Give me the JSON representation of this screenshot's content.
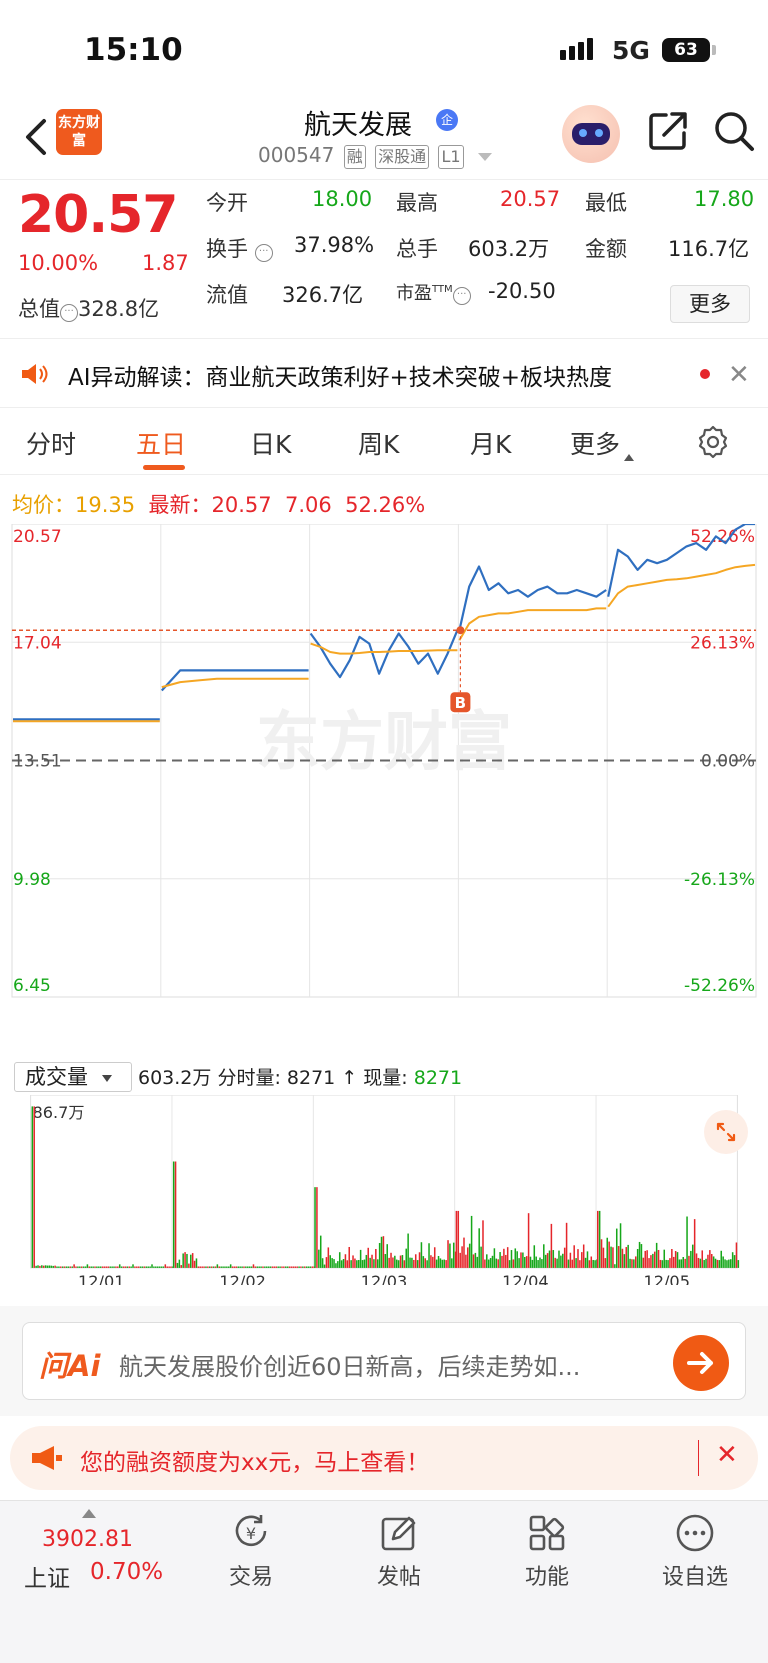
{
  "status": {
    "time": "15:10",
    "network": "5G",
    "battery": "63"
  },
  "header": {
    "logo_text": "东方财富",
    "title": "航天发展",
    "title_badge": "企",
    "code": "000547",
    "tags": [
      "融",
      "深股通",
      "L1"
    ]
  },
  "quote": {
    "price": "20.57",
    "pct": "10.00%",
    "change": "1.87",
    "total_value_label": "总值",
    "total_value": "328.8亿",
    "open_label": "今开",
    "open": "18.00",
    "high_label": "最高",
    "high": "20.57",
    "low_label": "最低",
    "low": "17.80",
    "turnover_label": "换手",
    "turnover": "37.98%",
    "volume_label": "总手",
    "volume": "603.2万",
    "amount_label": "金额",
    "amount": "116.7亿",
    "float_label": "流值",
    "float_value": "326.7亿",
    "pe_label": "市盈",
    "pe_sup": "TTM",
    "pe": "-20.50",
    "more_label": "更多"
  },
  "ai_banner": {
    "text": "AI异动解读：商业航天政策利好+技术突破+板块热度"
  },
  "tabs": [
    "分时",
    "五日",
    "日K",
    "周K",
    "月K",
    "更多"
  ],
  "avg_line": {
    "avg_label": "均价：",
    "avg": "19.35",
    "latest_label": "最新：",
    "latest": "20.57",
    "change": "7.06",
    "pct": "52.26%"
  },
  "chart_data": {
    "type": "line",
    "y_left_ticks": [
      "20.57",
      "17.04",
      "13.51",
      "9.98",
      "6.45"
    ],
    "y_right_ticks": [
      "52.26%",
      "26.13%",
      "0.00%",
      "-26.13%",
      "-52.26%"
    ],
    "x_ticks": [
      "12/01",
      "12/02",
      "12/03",
      "12/04",
      "12/05"
    ],
    "ylim": [
      6.45,
      20.57
    ],
    "base": 13.51,
    "marker_label": "B",
    "watermark": "东方财富",
    "series": [
      {
        "color": "#2f6fc0",
        "days": [
          [
            14.74,
            14.74,
            14.74,
            14.74,
            14.74,
            14.74,
            14.74,
            14.74
          ],
          [
            15.6,
            16.2,
            16.2,
            16.2,
            16.2,
            16.2,
            16.2,
            16.2,
            16.2
          ],
          [
            17.3,
            16.9,
            16.4,
            16.0,
            16.5,
            17.2,
            17.0,
            16.1,
            16.8,
            17.3,
            16.9,
            16.4,
            16.7,
            16.1,
            16.7,
            17.4
          ],
          [
            17.4,
            18.7,
            19.3,
            18.6,
            18.8,
            18.5,
            18.6,
            18.4,
            18.6,
            18.7,
            18.5,
            18.5,
            18.6,
            18.5,
            18.4,
            18.6
          ],
          [
            18.4,
            19.8,
            19.6,
            19.2,
            19.5,
            19.4,
            19.5,
            19.7,
            19.9,
            20.0,
            19.8,
            20.2,
            20.0,
            20.4,
            20.57,
            20.57
          ]
        ]
      },
      {
        "color": "#f5a623",
        "days": [
          [
            14.68,
            14.68,
            14.68,
            14.68,
            14.68,
            14.68,
            14.68,
            14.68
          ],
          [
            15.7,
            15.85,
            15.9,
            15.95,
            15.95,
            15.95,
            15.95,
            15.95,
            15.95
          ],
          [
            17.0,
            16.9,
            16.75,
            16.7,
            16.7,
            16.72,
            16.75,
            16.75,
            16.76,
            16.78,
            16.78,
            16.78,
            16.79,
            16.8,
            16.8,
            16.8
          ],
          [
            17.1,
            17.6,
            17.8,
            17.85,
            17.9,
            17.9,
            17.95,
            18.0,
            18.0,
            18.0,
            18.0,
            18.0,
            18.0,
            18.0,
            18.05,
            18.05
          ],
          [
            18.1,
            18.5,
            18.7,
            18.75,
            18.8,
            18.85,
            18.9,
            18.92,
            18.95,
            19.0,
            19.05,
            19.1,
            19.2,
            19.28,
            19.32,
            19.35
          ]
        ]
      }
    ]
  },
  "volume": {
    "selector": "成交量",
    "total": "603.2万",
    "detail_label": "分时量:",
    "detail": "8271",
    "arrow": "↑",
    "now_label": "现量:",
    "now": "8271",
    "ymax": "86.7万"
  },
  "ask": {
    "logo": "问Ai",
    "text": "航天发展股价创近60日新高，后续走势如..."
  },
  "promo": {
    "text": "您的融资额度为xx元，马上查看！"
  },
  "bottom": {
    "index_value": "3902.81",
    "index_name": "上证",
    "index_pct": "0.70%",
    "items": [
      "交易",
      "发帖",
      "功能",
      "设自选"
    ]
  }
}
